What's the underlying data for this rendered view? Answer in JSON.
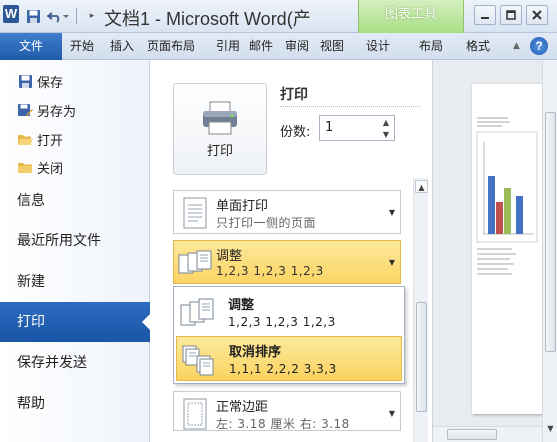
{
  "window": {
    "title": "文档1 - Microsoft Word(产",
    "contextual_group": "图表工具",
    "app_letter": "W"
  },
  "tabs": {
    "file": "文件",
    "home": "开始",
    "insert": "插入",
    "page_layout": "页面布局",
    "references": "引用",
    "mailings": "邮件",
    "review": "审阅",
    "view": "视图",
    "design": "设计",
    "layout": "布局",
    "format": "格式"
  },
  "nav": {
    "commands": {
      "save": "保存",
      "save_as": "另存为",
      "open": "打开",
      "close": "关闭"
    },
    "tabs": {
      "info": "信息",
      "recent": "最近所用文件",
      "new": "新建",
      "print": "打印",
      "save_send": "保存并发送",
      "help": "帮助"
    },
    "selected": "print"
  },
  "print": {
    "button_label": "打印",
    "heading": "打印",
    "copies_label": "份数:",
    "copies_value": "1",
    "sides": {
      "title": "单面打印",
      "subtitle": "只打印一侧的页面"
    },
    "collation": {
      "title": "调整",
      "subtitle": "1,2,3    1,2,3    1,2,3"
    },
    "collation_options": [
      {
        "title": "调整",
        "subtitle": "1,2,3    1,2,3    1,2,3"
      },
      {
        "title": "取消排序",
        "subtitle": "1,1,1    2,2,2    3,3,3"
      }
    ],
    "highlighted_option": "取消排序",
    "margins": {
      "title": "正常边距",
      "subtitle": "左: 3.18 厘米   右: 3.18"
    }
  },
  "preview": {
    "chart_series_colors": [
      "#4472c4",
      "#c0504d",
      "#9bbb59"
    ]
  },
  "colors": {
    "file_tab": "#2a64b6",
    "contextual_tab": "#a9de86",
    "selection_highlight": "#fbd564",
    "nav_selected": "#1f5aa7"
  }
}
